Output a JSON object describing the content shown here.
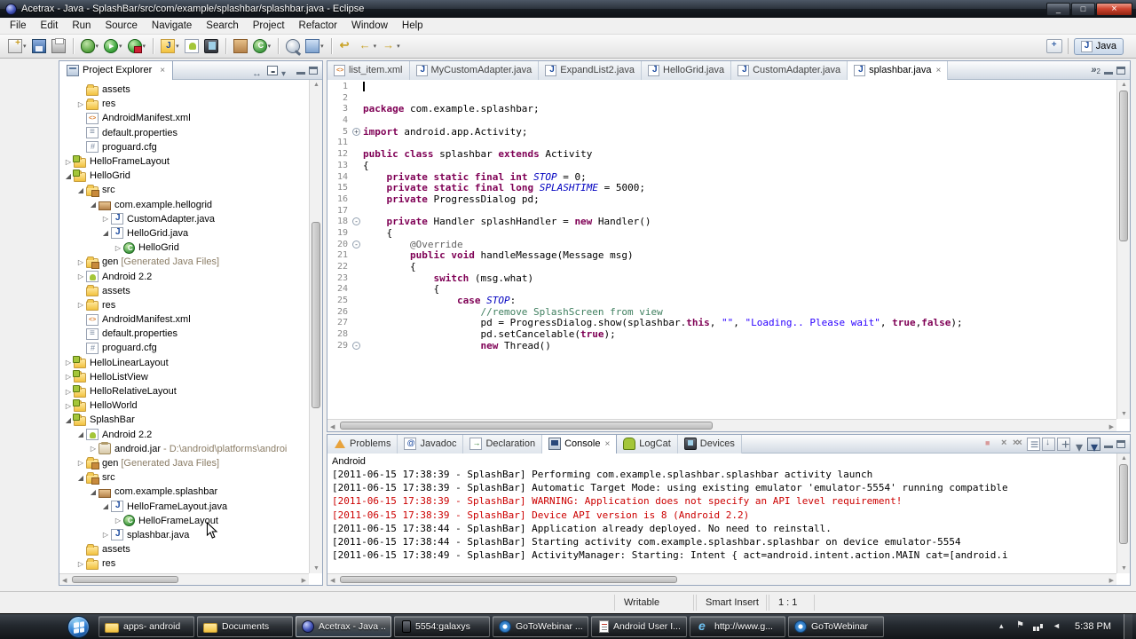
{
  "colors": {
    "keyword": "#7f0055",
    "string": "#2a00ff",
    "comment": "#3f7f5f",
    "log_error": "#cc0000",
    "android_green": "#a4c639"
  },
  "window": {
    "title": "Acetrax - Java - SplashBar/src/com/example/splashbar/splashbar.java - Eclipse"
  },
  "menubar": {
    "items": [
      "File",
      "Edit",
      "Run",
      "Source",
      "Navigate",
      "Search",
      "Project",
      "Refactor",
      "Window",
      "Help"
    ]
  },
  "toolbar": {
    "groups": [
      [
        {
          "icon": "new",
          "dd": true
        },
        {
          "icon": "save",
          "dd": false
        },
        {
          "icon": "print",
          "dd": false
        }
      ],
      [
        {
          "icon": "debug",
          "dd": true
        },
        {
          "icon": "run",
          "dd": true
        },
        {
          "icon": "external-tools",
          "dd": true
        }
      ],
      [
        {
          "icon": "new-java-project",
          "dd": true
        },
        {
          "icon": "android-sdk",
          "dd": false
        },
        {
          "icon": "avd-manager",
          "dd": false
        }
      ],
      [
        {
          "icon": "new-package",
          "dd": false
        },
        {
          "icon": "new-class",
          "dd": true
        }
      ],
      [
        {
          "icon": "search",
          "dd": false
        },
        {
          "icon": "open-task",
          "dd": true
        }
      ],
      [
        {
          "icon": "last-edit",
          "dd": false
        },
        {
          "icon": "back",
          "dd": true
        },
        {
          "icon": "forward",
          "dd": true
        }
      ]
    ],
    "perspective_label": "Java"
  },
  "explorer": {
    "title": "Project Explorer",
    "tree": [
      {
        "indent": 1,
        "arrow": "",
        "icon": "folder",
        "label": "assets"
      },
      {
        "indent": 1,
        "arrow": "c",
        "icon": "folder",
        "label": "res"
      },
      {
        "indent": 1,
        "arrow": "",
        "icon": "xml",
        "label": "AndroidManifest.xml"
      },
      {
        "indent": 1,
        "arrow": "",
        "icon": "props",
        "label": "default.properties"
      },
      {
        "indent": 1,
        "arrow": "",
        "icon": "cfg",
        "label": "proguard.cfg"
      },
      {
        "indent": 0,
        "arrow": "c",
        "icon": "project",
        "label": "HelloFrameLayout"
      },
      {
        "indent": 0,
        "arrow": "e",
        "icon": "project",
        "label": "HelloGrid"
      },
      {
        "indent": 1,
        "arrow": "e",
        "icon": "src",
        "label": "src"
      },
      {
        "indent": 2,
        "arrow": "e",
        "icon": "package",
        "label": "com.example.hellogrid"
      },
      {
        "indent": 3,
        "arrow": "c",
        "icon": "java",
        "label": "CustomAdapter.java"
      },
      {
        "indent": 3,
        "arrow": "e",
        "icon": "java",
        "label": "HelloGrid.java"
      },
      {
        "indent": 4,
        "arrow": "c",
        "icon": "class",
        "label": "HelloGrid"
      },
      {
        "indent": 1,
        "arrow": "c",
        "icon": "src",
        "label": "gen",
        "suffix": "[Generated Java Files]"
      },
      {
        "indent": 1,
        "arrow": "c",
        "icon": "android",
        "label": "Android 2.2"
      },
      {
        "indent": 1,
        "arrow": "",
        "icon": "folder",
        "label": "assets"
      },
      {
        "indent": 1,
        "arrow": "c",
        "icon": "folder",
        "label": "res"
      },
      {
        "indent": 1,
        "arrow": "",
        "icon": "xml",
        "label": "AndroidManifest.xml"
      },
      {
        "indent": 1,
        "arrow": "",
        "icon": "props",
        "label": "default.properties"
      },
      {
        "indent": 1,
        "arrow": "",
        "icon": "cfg",
        "label": "proguard.cfg"
      },
      {
        "indent": 0,
        "arrow": "c",
        "icon": "project",
        "label": "HelloLinearLayout"
      },
      {
        "indent": 0,
        "arrow": "c",
        "icon": "project",
        "label": "HelloListView"
      },
      {
        "indent": 0,
        "arrow": "c",
        "icon": "project",
        "label": "HelloRelativeLayout"
      },
      {
        "indent": 0,
        "arrow": "c",
        "icon": "project",
        "label": "HelloWorld"
      },
      {
        "indent": 0,
        "arrow": "e",
        "icon": "project",
        "label": "SplashBar"
      },
      {
        "indent": 1,
        "arrow": "e",
        "icon": "android",
        "label": "Android 2.2"
      },
      {
        "indent": 2,
        "arrow": "c",
        "icon": "jar",
        "label": "android.jar",
        "suffix": "- D:\\android\\platforms\\androi"
      },
      {
        "indent": 1,
        "arrow": "c",
        "icon": "src",
        "label": "gen",
        "suffix": "[Generated Java Files]"
      },
      {
        "indent": 1,
        "arrow": "e",
        "icon": "src",
        "label": "src"
      },
      {
        "indent": 2,
        "arrow": "e",
        "icon": "package",
        "label": "com.example.splashbar"
      },
      {
        "indent": 3,
        "arrow": "e",
        "icon": "java",
        "label": "HelloFrameLayout.java"
      },
      {
        "indent": 4,
        "arrow": "c",
        "icon": "class",
        "label": "HelloFrameLayout"
      },
      {
        "indent": 3,
        "arrow": "c",
        "icon": "java",
        "label": "splashbar.java"
      },
      {
        "indent": 1,
        "arrow": "",
        "icon": "folder",
        "label": "assets"
      },
      {
        "indent": 1,
        "arrow": "c",
        "icon": "folder",
        "label": "res"
      }
    ]
  },
  "editor": {
    "overflow_count": "2",
    "tabs": [
      {
        "label": "list_item.xml",
        "icon": "xml",
        "active": false
      },
      {
        "label": "MyCustomAdapter.java",
        "icon": "java",
        "active": false
      },
      {
        "label": "ExpandList2.java",
        "icon": "java",
        "active": false
      },
      {
        "label": "HelloGrid.java",
        "icon": "java",
        "active": false
      },
      {
        "label": "CustomAdapter.java",
        "icon": "java",
        "active": false
      },
      {
        "label": "splashbar.java",
        "icon": "java",
        "active": true
      }
    ],
    "lines": [
      {
        "n": "1",
        "fold": "",
        "cursor": true,
        "seg": []
      },
      {
        "n": "2",
        "fold": "",
        "seg": []
      },
      {
        "n": "3",
        "fold": "",
        "seg": [
          [
            "k",
            "package"
          ],
          [
            "p",
            " com.example.splashbar;"
          ]
        ]
      },
      {
        "n": "4",
        "fold": "",
        "seg": []
      },
      {
        "n": "5",
        "fold": "+",
        "seg": [
          [
            "k",
            "import"
          ],
          [
            "p",
            " android.app.Activity;"
          ]
        ]
      },
      {
        "n": "11",
        "fold": "",
        "seg": []
      },
      {
        "n": "12",
        "fold": "",
        "seg": [
          [
            "k",
            "public"
          ],
          [
            "p",
            " "
          ],
          [
            "k",
            "class"
          ],
          [
            "p",
            " splashbar "
          ],
          [
            "k",
            "extends"
          ],
          [
            "p",
            " Activity"
          ]
        ]
      },
      {
        "n": "13",
        "fold": "",
        "seg": [
          [
            "p",
            "{"
          ]
        ]
      },
      {
        "n": "14",
        "fold": "",
        "seg": [
          [
            "p",
            "    "
          ],
          [
            "k",
            "private"
          ],
          [
            "p",
            " "
          ],
          [
            "k",
            "static"
          ],
          [
            "p",
            " "
          ],
          [
            "k",
            "final"
          ],
          [
            "p",
            " "
          ],
          [
            "k",
            "int"
          ],
          [
            "p",
            " "
          ],
          [
            "f",
            "STOP"
          ],
          [
            "p",
            " = 0;"
          ]
        ]
      },
      {
        "n": "15",
        "fold": "",
        "seg": [
          [
            "p",
            "    "
          ],
          [
            "k",
            "private"
          ],
          [
            "p",
            " "
          ],
          [
            "k",
            "static"
          ],
          [
            "p",
            " "
          ],
          [
            "k",
            "final"
          ],
          [
            "p",
            " "
          ],
          [
            "k",
            "long"
          ],
          [
            "p",
            " "
          ],
          [
            "f",
            "SPLASHTIME"
          ],
          [
            "p",
            " = 5000;"
          ]
        ]
      },
      {
        "n": "16",
        "fold": "",
        "seg": [
          [
            "p",
            "    "
          ],
          [
            "k",
            "private"
          ],
          [
            "p",
            " ProgressDialog pd;"
          ]
        ]
      },
      {
        "n": "17",
        "fold": "",
        "seg": []
      },
      {
        "n": "18",
        "fold": "-",
        "seg": [
          [
            "p",
            "    "
          ],
          [
            "k",
            "private"
          ],
          [
            "p",
            " Handler splashHandler = "
          ],
          [
            "k",
            "new"
          ],
          [
            "p",
            " Handler()"
          ]
        ]
      },
      {
        "n": "19",
        "fold": "",
        "seg": [
          [
            "p",
            "    {"
          ]
        ]
      },
      {
        "n": "20",
        "fold": "-",
        "seg": [
          [
            "p",
            "        "
          ],
          [
            "a",
            "@Override"
          ]
        ]
      },
      {
        "n": "21",
        "fold": "",
        "seg": [
          [
            "p",
            "        "
          ],
          [
            "k",
            "public"
          ],
          [
            "p",
            " "
          ],
          [
            "k",
            "void"
          ],
          [
            "p",
            " handleMessage(Message msg)"
          ]
        ]
      },
      {
        "n": "22",
        "fold": "",
        "seg": [
          [
            "p",
            "        {"
          ]
        ]
      },
      {
        "n": "23",
        "fold": "",
        "seg": [
          [
            "p",
            "            "
          ],
          [
            "k",
            "switch"
          ],
          [
            "p",
            " (msg.what)"
          ]
        ]
      },
      {
        "n": "24",
        "fold": "",
        "seg": [
          [
            "p",
            "            {"
          ]
        ]
      },
      {
        "n": "25",
        "fold": "",
        "seg": [
          [
            "p",
            "                "
          ],
          [
            "k",
            "case"
          ],
          [
            "p",
            " "
          ],
          [
            "f",
            "STOP"
          ],
          [
            "p",
            ":"
          ]
        ]
      },
      {
        "n": "26",
        "fold": "",
        "seg": [
          [
            "p",
            "                    "
          ],
          [
            "c",
            "//remove SplashScreen from view"
          ]
        ]
      },
      {
        "n": "27",
        "fold": "",
        "seg": [
          [
            "p",
            "                    pd = ProgressDialog.show(splashbar."
          ],
          [
            "k",
            "this"
          ],
          [
            "p",
            ", "
          ],
          [
            "s",
            "\"\""
          ],
          [
            "p",
            ", "
          ],
          [
            "s",
            "\"Loading.. Please wait\""
          ],
          [
            "p",
            ", "
          ],
          [
            "k",
            "true"
          ],
          [
            "p",
            ","
          ],
          [
            "k",
            "false"
          ],
          [
            "p",
            ");"
          ]
        ]
      },
      {
        "n": "28",
        "fold": "",
        "seg": [
          [
            "p",
            "                    pd.setCancelable("
          ],
          [
            "k",
            "true"
          ],
          [
            "p",
            ");"
          ]
        ]
      },
      {
        "n": "29",
        "fold": "-",
        "seg": [
          [
            "p",
            "                    "
          ],
          [
            "k",
            "new"
          ],
          [
            "p",
            " Thread()"
          ]
        ]
      }
    ]
  },
  "console": {
    "title": "Android",
    "tabs": [
      {
        "label": "Problems",
        "icon": "problems",
        "active": false
      },
      {
        "label": "Javadoc",
        "icon": "javadoc",
        "active": false
      },
      {
        "label": "Declaration",
        "icon": "declaration",
        "active": false
      },
      {
        "label": "Console",
        "icon": "console",
        "active": true
      },
      {
        "label": "LogCat",
        "icon": "logcat",
        "active": false
      },
      {
        "label": "Devices",
        "icon": "devices",
        "active": false
      }
    ],
    "toolbar_icons": [
      "terminate",
      "remove-launch",
      "remove-all",
      "clear-console",
      "scroll-lock",
      "pin-console",
      "display-console",
      "open-console"
    ],
    "lines": [
      {
        "type": "info",
        "text": "[2011-06-15 17:38:39 - SplashBar] Performing com.example.splashbar.splashbar activity launch"
      },
      {
        "type": "info",
        "text": "[2011-06-15 17:38:39 - SplashBar] Automatic Target Mode: using existing emulator 'emulator-5554' running compatible"
      },
      {
        "type": "error",
        "text": "[2011-06-15 17:38:39 - SplashBar] WARNING: Application does not specify an API level requirement!"
      },
      {
        "type": "error",
        "text": "[2011-06-15 17:38:39 - SplashBar] Device API version is 8 (Android 2.2)"
      },
      {
        "type": "info",
        "text": "[2011-06-15 17:38:44 - SplashBar] Application already deployed. No need to reinstall."
      },
      {
        "type": "info",
        "text": "[2011-06-15 17:38:44 - SplashBar] Starting activity com.example.splashbar.splashbar on device emulator-5554"
      },
      {
        "type": "info",
        "text": "[2011-06-15 17:38:49 - SplashBar] ActivityManager: Starting: Intent { act=android.intent.action.MAIN cat=[android.i"
      }
    ]
  },
  "statusbar": {
    "writable": "Writable",
    "insert_mode": "Smart Insert",
    "caret_position": "1 : 1"
  },
  "taskbar": {
    "items": [
      {
        "label": "apps- android",
        "icon": "folder",
        "active": false
      },
      {
        "label": "Documents",
        "icon": "folder",
        "active": false
      },
      {
        "label": "Acetrax - Java ...",
        "icon": "eclipse",
        "active": true
      },
      {
        "label": "5554:galaxys",
        "icon": "emulator",
        "active": false
      },
      {
        "label": "GoToWebinar ...",
        "icon": "webinar",
        "active": false
      },
      {
        "label": "Android User I...",
        "icon": "doc",
        "active": false
      },
      {
        "label": "http://www.g...",
        "icon": "ie",
        "active": false
      },
      {
        "label": "GoToWebinar",
        "icon": "webinar",
        "active": false
      }
    ],
    "tray_icons": [
      "hidden-icons",
      "action-center",
      "network",
      "volume"
    ],
    "clock": "5:38 PM"
  }
}
